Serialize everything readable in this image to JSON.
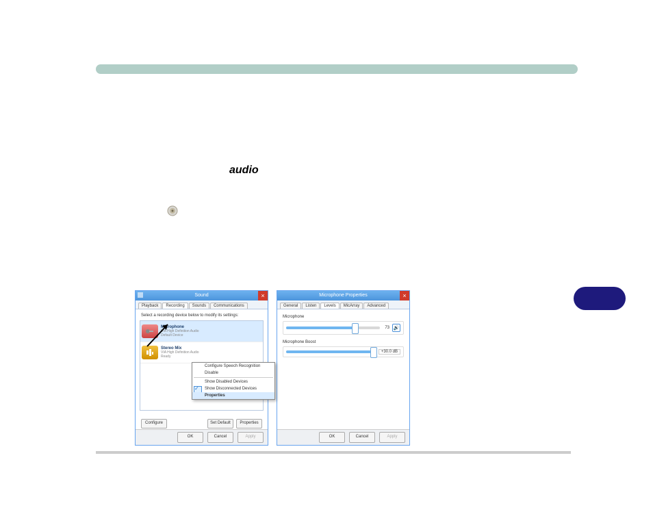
{
  "heading_audio": "audio",
  "sound_dialog": {
    "title": "Sound",
    "tabs": [
      "Playback",
      "Recording",
      "Sounds",
      "Communications"
    ],
    "active_tab_index": 1,
    "instruction": "Select a recording device below to modify its settings:",
    "devices": [
      {
        "name": "Microphone",
        "sub": "VIA High Definition Audio",
        "status": "Default Device",
        "selected": true
      },
      {
        "name": "Stereo Mix",
        "sub": "VIA High Definition Audio",
        "status": "Ready",
        "selected": false
      }
    ],
    "context_menu": {
      "items": [
        "Configure Speech Recognition",
        "Disable",
        "Show Disabled Devices",
        "Show Disconnected Devices",
        "Properties"
      ],
      "checked_index": 3,
      "highlight_index": 4
    },
    "footer": {
      "configure": "Configure",
      "set_default": "Set Default",
      "properties": "Properties"
    },
    "buttons": {
      "ok": "OK",
      "cancel": "Cancel",
      "apply": "Apply"
    }
  },
  "mic_dialog": {
    "title": "Microphone Properties",
    "tabs": [
      "General",
      "Listen",
      "Levels",
      "MicArray",
      "Advanced"
    ],
    "active_tab_index": 2,
    "level": {
      "label": "Microphone",
      "value": 73,
      "max": 100
    },
    "boost": {
      "label": "Microphone Boost",
      "value_text": "+30.0 dB",
      "percent": 100
    },
    "buttons": {
      "ok": "OK",
      "cancel": "Cancel",
      "apply": "Apply"
    }
  }
}
